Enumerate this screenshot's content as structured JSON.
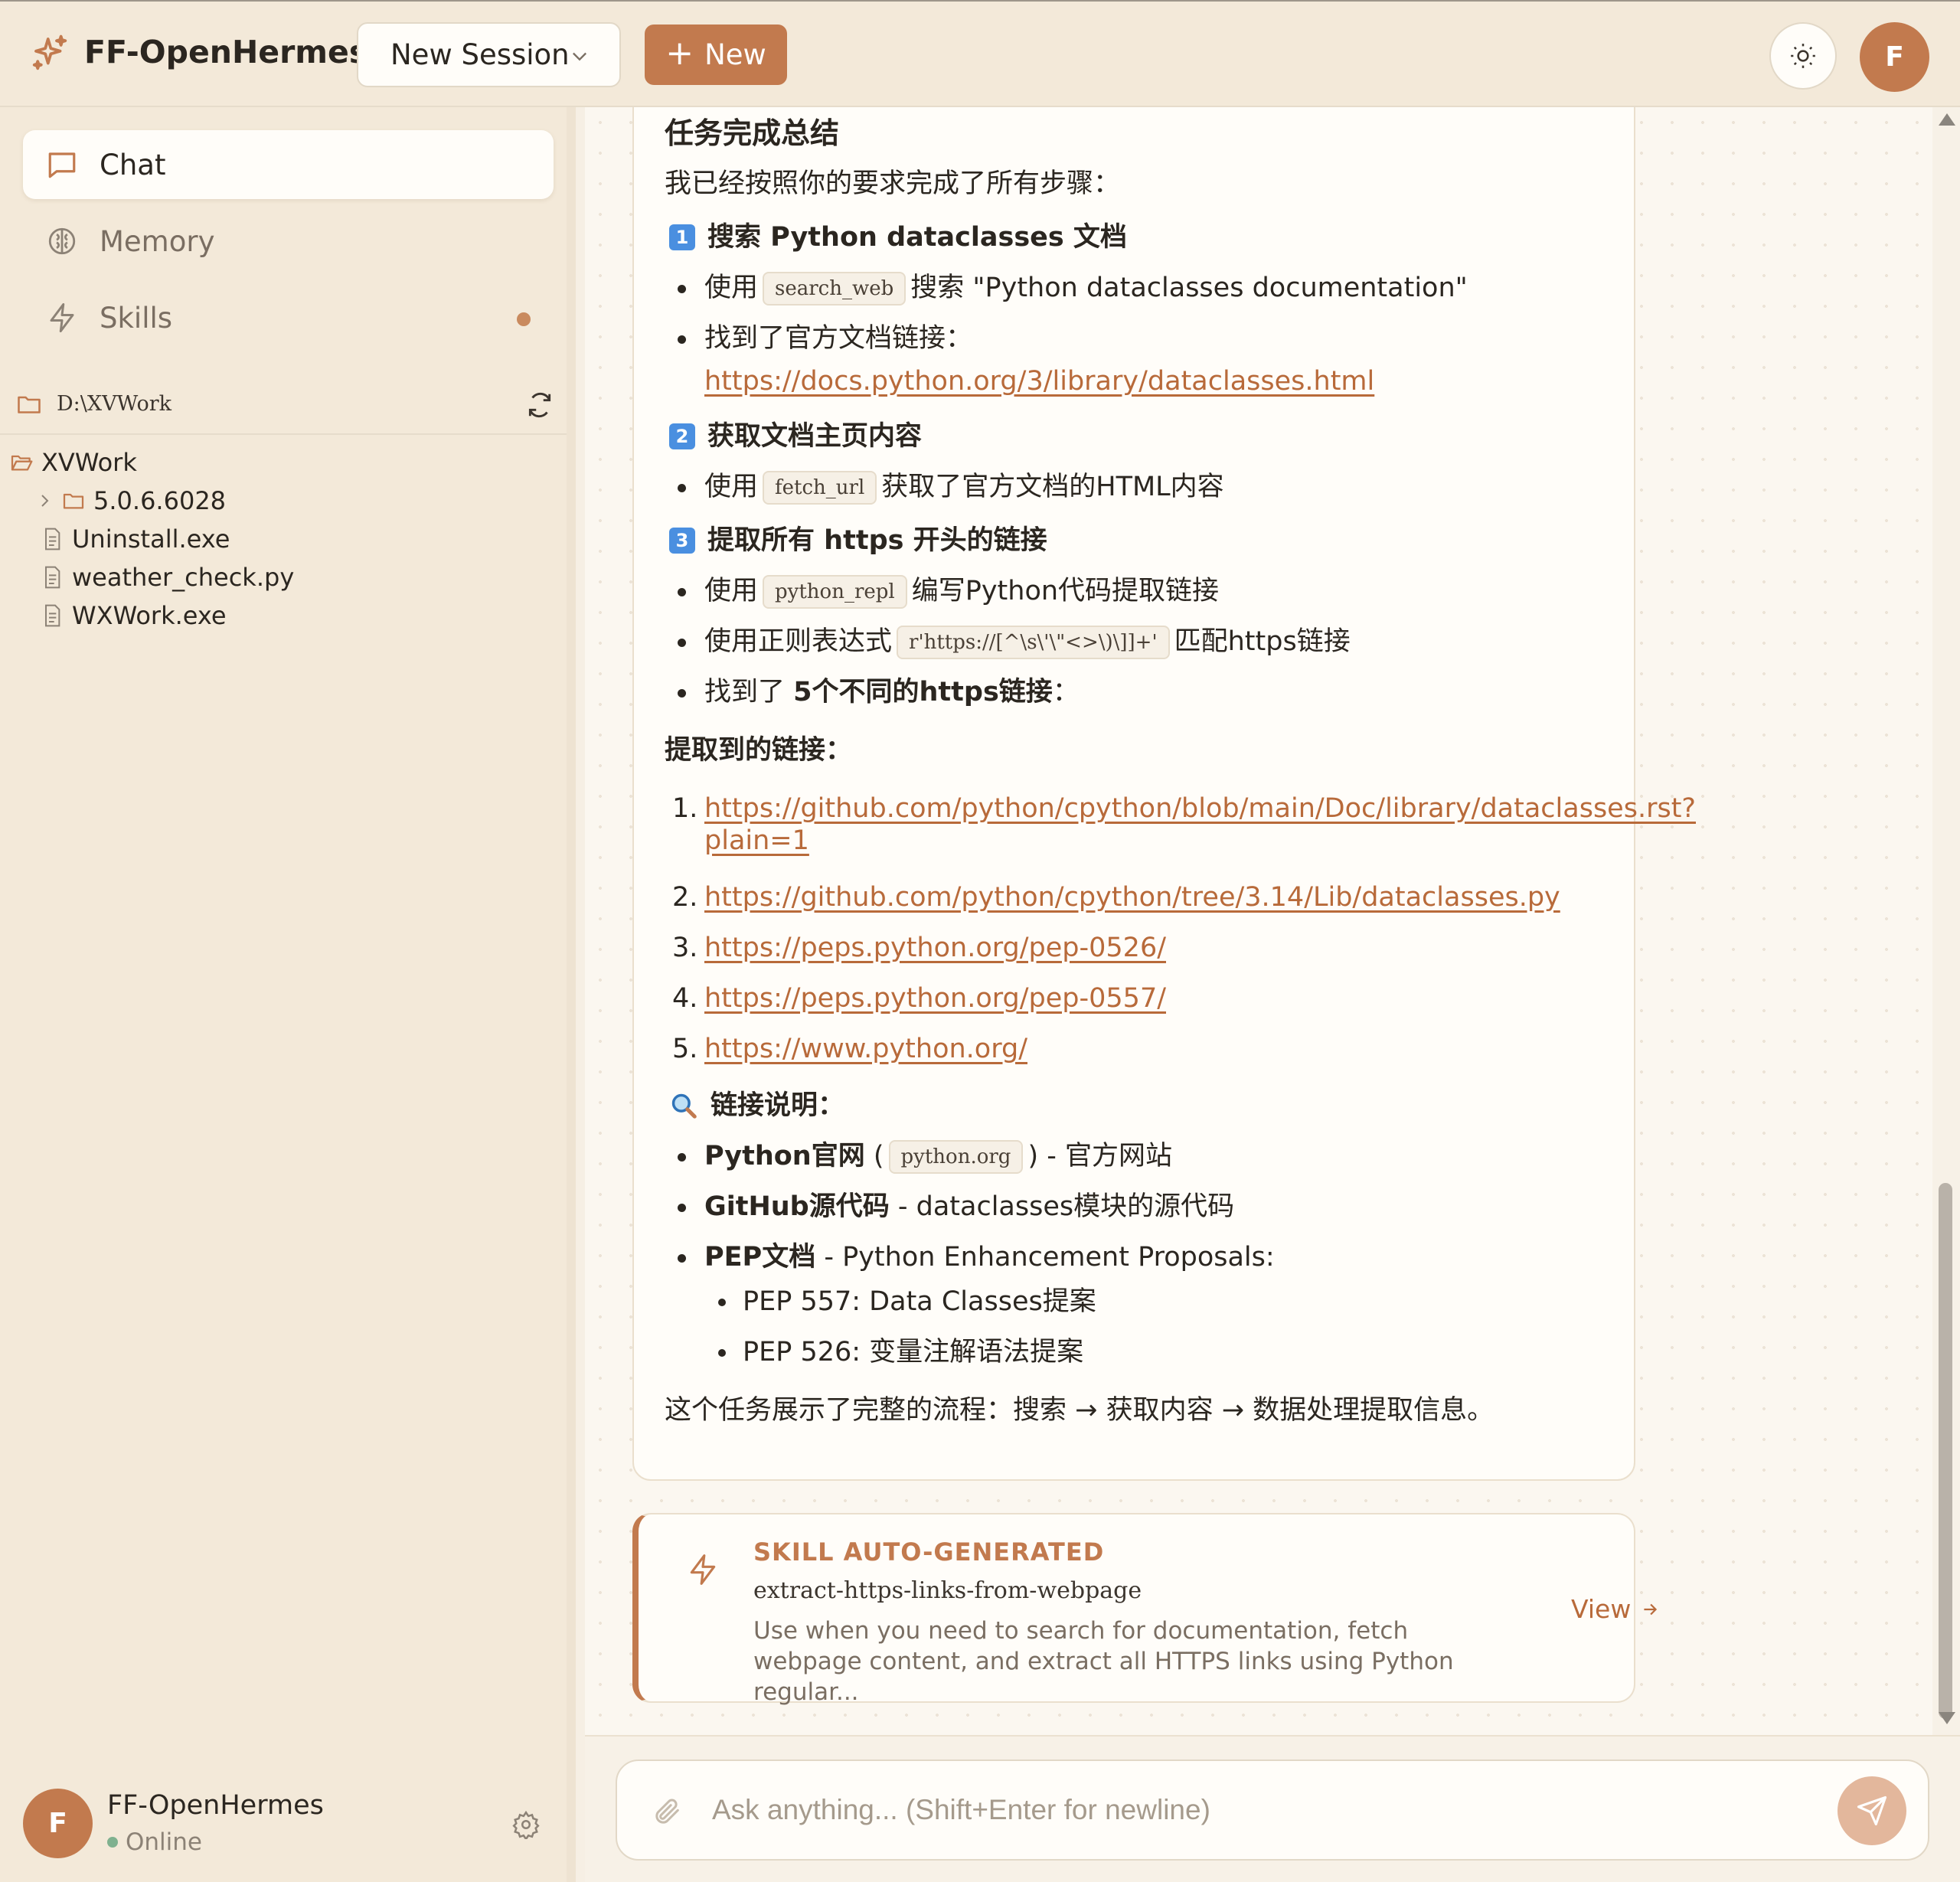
{
  "header": {
    "brand": "FF-OpenHermes",
    "session_label": "New Session",
    "new_button": "New",
    "avatar_letter": "F"
  },
  "sidebar": {
    "nav": [
      {
        "label": "Chat",
        "icon": "message-square-icon",
        "active": true
      },
      {
        "label": "Memory",
        "icon": "brain-icon",
        "active": false
      },
      {
        "label": "Skills",
        "icon": "zap-icon",
        "active": false,
        "badge_dot": true
      }
    ],
    "path": "D:\\XVWork",
    "tree": [
      {
        "label": "XVWork",
        "type": "folder-open"
      },
      {
        "label": "5.0.6.6028",
        "type": "folder"
      },
      {
        "label": "Uninstall.exe",
        "type": "file"
      },
      {
        "label": "weather_check.py",
        "type": "file"
      },
      {
        "label": "WXWork.exe",
        "type": "file"
      }
    ],
    "user": {
      "name": "FF-OpenHermes",
      "status": "Online",
      "avatar_letter": "F"
    }
  },
  "message": {
    "title": "任务完成总结",
    "intro": "我已经按照你的要求完成了所有步骤：",
    "step1": {
      "num": "1",
      "heading": "搜索 Python dataclasses 文档",
      "b1_pre": "使用",
      "b1_code": "search_web",
      "b1_post": "搜索 \"Python dataclasses documentation\"",
      "b2": "找到了官方文档链接：",
      "b2_link": "https://docs.python.org/3/library/dataclasses.html"
    },
    "step2": {
      "num": "2",
      "heading": "获取文档主页内容",
      "b1_pre": "使用",
      "b1_code": "fetch_url",
      "b1_post": "获取了官方文档的HTML内容"
    },
    "step3": {
      "num": "3",
      "heading": "提取所有 https 开头的链接",
      "b1_pre": "使用",
      "b1_code": "python_repl",
      "b1_post": "编写Python代码提取链接",
      "b2_pre": "使用正则表达式",
      "b2_code": "r'https://[^\\s\\'\\\"<>\\)\\]]+'",
      "b2_post": "匹配https链接",
      "b3_pre": "找到了",
      "b3_bold": "5个不同的https链接",
      "b3_post": "："
    },
    "links_heading": "提取到的链接：",
    "links": [
      {
        "num": "1.",
        "line1": "https://github.com/python/cpython/blob/main/Doc/library/dataclasses.rst?",
        "line2": "plain=1"
      },
      {
        "num": "2.",
        "line1": "https://github.com/python/cpython/tree/3.14/Lib/dataclasses.py"
      },
      {
        "num": "3.",
        "line1": "https://peps.python.org/pep-0526/"
      },
      {
        "num": "4.",
        "line1": "https://peps.python.org/pep-0557/"
      },
      {
        "num": "5.",
        "line1": "https://www.python.org/"
      }
    ],
    "explain_heading": "链接说明：",
    "explain": {
      "e1_bold": "Python官网",
      "e1_open": " (",
      "e1_code": "python.org",
      "e1_post": ") - 官方网站",
      "e2_bold": "GitHub源代码",
      "e2_post": " - dataclasses模块的源代码",
      "e3_bold": "PEP文档",
      "e3_post": " - Python Enhancement Proposals:",
      "sub1": "PEP 557: Data Classes提案",
      "sub2": "PEP 526: 变量注解语法提案"
    },
    "conclusion": "这个任务展示了完整的流程：搜索 → 获取内容 → 数据处理提取信息。"
  },
  "skill_card": {
    "tag": "SKILL AUTO-GENERATED",
    "name": "extract-https-links-from-webpage",
    "description": "Use when you need to search for documentation, fetch webpage content, and extract all HTTPS links using Python regular...",
    "view_label": "View"
  },
  "composer": {
    "placeholder": "Ask anything... (Shift+Enter for newline)"
  },
  "colors": {
    "accent": "#c27a4e",
    "link": "#b86a3a",
    "background": "#f3e9d9",
    "online": "#7fb18f"
  }
}
